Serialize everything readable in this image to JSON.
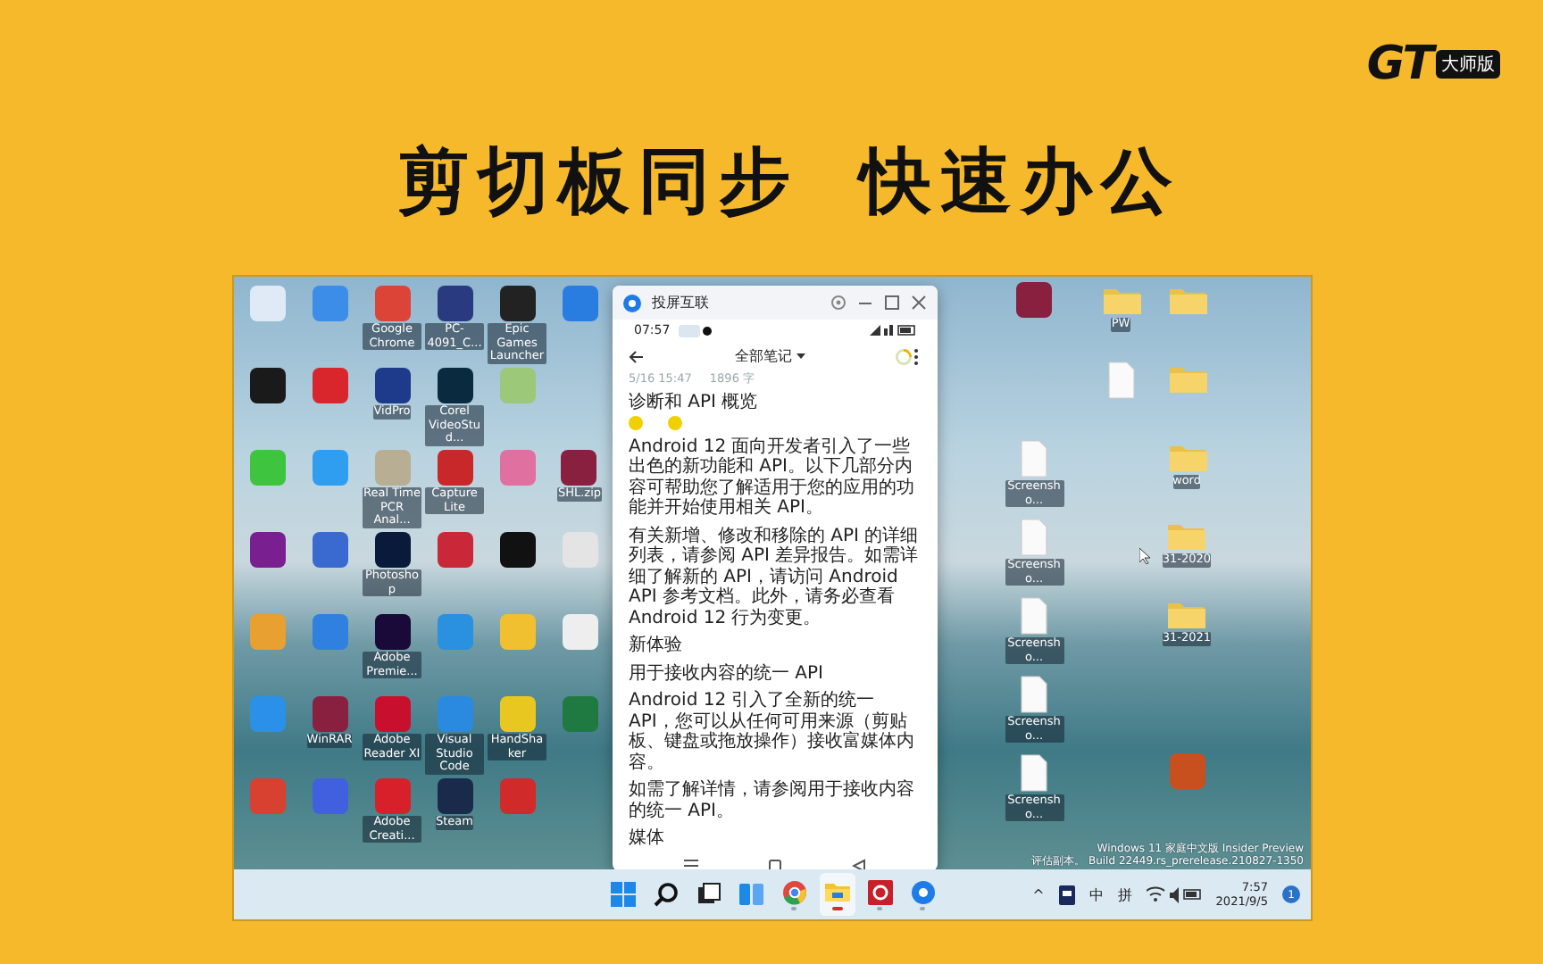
{
  "logo": {
    "mark": "GT",
    "badge": "大师版"
  },
  "headline": [
    "剪切板同步",
    "快速办公"
  ],
  "desktop": {
    "left_icons": [
      [
        {
          "kind": "app",
          "color": "#dfeaf6"
        },
        {
          "kind": "app",
          "color": "#3b8de8"
        },
        {
          "kind": "app",
          "color": "#db4437",
          "label": "Google Chrome"
        },
        {
          "kind": "app",
          "color": "#2a3a80",
          "label": "PC-4091_C..."
        },
        {
          "kind": "app",
          "color": "#222222",
          "label": "Epic Games Launcher"
        },
        {
          "kind": "app",
          "color": "#2a7de0"
        }
      ],
      [
        {
          "kind": "app",
          "color": "#1a1a1a"
        },
        {
          "kind": "app",
          "color": "#d9262c"
        },
        {
          "kind": "app",
          "color": "#1e3a8a",
          "label": "VidPro"
        },
        {
          "kind": "app",
          "color": "#0a2a40",
          "label": "Corel VideoStud..."
        },
        {
          "kind": "app",
          "color": "#9cc87a"
        }
      ],
      [
        {
          "kind": "app",
          "color": "#3fc43f"
        },
        {
          "kind": "app",
          "color": "#2f9df0"
        },
        {
          "kind": "app",
          "color": "#b8ae94",
          "label": "Real Time PCR Anal..."
        },
        {
          "kind": "app",
          "color": "#c8282a",
          "label": "Capture Lite"
        },
        {
          "kind": "app",
          "color": "#e070a0"
        },
        {
          "kind": "app",
          "color": "#8a2040",
          "label": "SHL.zip"
        }
      ],
      [
        {
          "kind": "app",
          "color": "#7a1f8f"
        },
        {
          "kind": "app",
          "color": "#3a6ad0"
        },
        {
          "kind": "app",
          "color": "#0a1a3a",
          "label": "Photoshop"
        },
        {
          "kind": "app",
          "color": "#c82838"
        },
        {
          "kind": "app",
          "color": "#111111"
        },
        {
          "kind": "app",
          "color": "#e4e4e4"
        }
      ],
      [
        {
          "kind": "app",
          "color": "#e8a030"
        },
        {
          "kind": "app",
          "color": "#3080e0"
        },
        {
          "kind": "app",
          "color": "#1a0a3a",
          "label": "Adobe Premie..."
        },
        {
          "kind": "app",
          "color": "#2a90e0"
        },
        {
          "kind": "app",
          "color": "#f0c030"
        },
        {
          "kind": "app",
          "color": "#eeeeee"
        }
      ],
      [
        {
          "kind": "app",
          "color": "#2a90e8"
        },
        {
          "kind": "app",
          "color": "#8a2040",
          "label": "WinRAR"
        },
        {
          "kind": "app",
          "color": "#c8102e",
          "label": "Adobe Reader XI"
        },
        {
          "kind": "app",
          "color": "#2a8ae0",
          "label": "Visual Studio Code"
        },
        {
          "kind": "app",
          "color": "#e8c820",
          "label": "HandShaker"
        },
        {
          "kind": "app",
          "color": "#1e7a40"
        }
      ],
      [
        {
          "kind": "app",
          "color": "#d84030"
        },
        {
          "kind": "app",
          "color": "#4060e0"
        },
        {
          "kind": "app",
          "color": "#d8202a",
          "label": "Adobe Creati..."
        },
        {
          "kind": "app",
          "color": "#1a2a4a",
          "label": "Steam"
        },
        {
          "kind": "app",
          "color": "#d02a2a"
        }
      ]
    ],
    "right_icon_columns": [
      [
        {
          "kind": "app",
          "color": "#8a2040"
        },
        null,
        {
          "kind": "file",
          "label": "Screensho..."
        },
        {
          "kind": "file",
          "label": "Screensho..."
        },
        {
          "kind": "file",
          "label": "Screensho..."
        },
        {
          "kind": "file",
          "label": "Screensho..."
        },
        {
          "kind": "file",
          "label": "Screensho..."
        }
      ],
      [
        {
          "kind": "folder",
          "label": "PW"
        },
        {
          "kind": "file"
        }
      ],
      [
        {
          "kind": "folder"
        },
        {
          "kind": "folder"
        },
        {
          "kind": "folder",
          "label": "word"
        },
        {
          "kind": "folder",
          "label": "31-2020"
        },
        {
          "kind": "folder",
          "label": "31-2021"
        },
        null,
        {
          "kind": "app",
          "color": "#c8501e"
        }
      ]
    ],
    "os_notice": [
      "Windows 11 家庭中文版 Insider Preview",
      "评估副本。 Build 22449.rs_prerelease.210827-1350"
    ]
  },
  "phone": {
    "title": "投屏互联",
    "status_time": "07:57",
    "notes_title": "全部笔记",
    "meta": [
      "5/16 15:47",
      "1896 字"
    ],
    "heading": "诊断和 API 概览",
    "paragraphs": [
      "Android 12 面向开发者引入了一些出色的新功能和 API。以下几部分内容可帮助您了解适用于您的应用的功能并开始使用相关 API。",
      "有关新增、修改和移除的 API 的详细列表，请参阅 API 差异报告。如需详细了解新的 API，请访问 Android API 参考文档。此外，请务必查看 Android 12 行为变更。",
      "新体验",
      "用于接收内容的统一 API",
      "Android 12 引入了全新的统一 API，您可以从任何可用来源（剪贴板、键盘或拖放操作）接收富媒体内容。",
      "如需了解详情，请参阅用于接收内容的统一 API。",
      "媒体"
    ]
  },
  "taskbar": {
    "apps": [
      {
        "kind": "start",
        "running": false,
        "selected": false
      },
      {
        "kind": "search",
        "running": false,
        "selected": false
      },
      {
        "kind": "taskview",
        "running": false,
        "selected": false
      },
      {
        "kind": "widgets",
        "running": false,
        "selected": false
      },
      {
        "kind": "browser",
        "running": true,
        "selected": false
      },
      {
        "kind": "explorer",
        "running": true,
        "selected": true
      },
      {
        "kind": "camera",
        "running": true,
        "selected": false
      },
      {
        "kind": "mirror",
        "running": true,
        "selected": false
      }
    ],
    "tray": {
      "chevron": "^",
      "ime": [
        "中",
        "拼"
      ],
      "time": "7:57",
      "date": "2021/9/5",
      "notifications": "1"
    }
  }
}
